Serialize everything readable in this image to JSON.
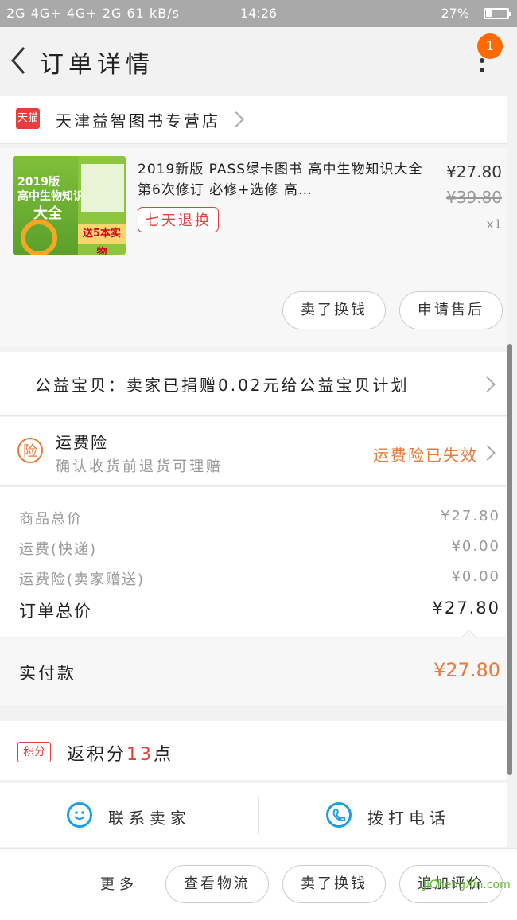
{
  "status_bar": {
    "signal": "2G 4G+ 4G+ 2G",
    "speed": "61 kB/s",
    "time": "14:26",
    "battery": "27%"
  },
  "nav": {
    "title": "订单详情",
    "badge": "1"
  },
  "shop": {
    "icon_text": "天猫",
    "name": "天津益智图书专营店"
  },
  "product": {
    "title": "2019新版 PASS绿卡图书 高中生物知识大全 第6次修订 必修+选修 高…",
    "tag": "七天退换",
    "price": "¥27.80",
    "original_price": "¥39.80",
    "quantity": "x1",
    "cover": {
      "badge": "2019版",
      "line1": "高中生物知识",
      "line2": "大全",
      "promo": "送5本实物"
    },
    "actions": [
      "卖了换钱",
      "申请售后"
    ]
  },
  "charity": {
    "text": "公益宝贝：卖家已捐赠0.02元给公益宝贝计划"
  },
  "insurance": {
    "icon": "险",
    "title": "运费险",
    "subtitle": "确认收货前退货可理赔",
    "status": "运费险已失效"
  },
  "summary": [
    {
      "label": "商品总价",
      "value": "¥27.80"
    },
    {
      "label": "运费(快递)",
      "value": "¥0.00"
    },
    {
      "label": "运费险(卖家赠送)",
      "value": "¥0.00"
    },
    {
      "label": "订单总价",
      "value": "¥27.80"
    }
  ],
  "payment": {
    "label": "实付款",
    "value": "¥27.80"
  },
  "points": {
    "icon": "积分",
    "prefix": "返积分",
    "number": "13",
    "suffix": "点"
  },
  "contact": {
    "seller": "联系卖家",
    "phone": "拨打电话"
  },
  "bottom_bar": {
    "more": "更多",
    "buttons": [
      "查看物流",
      "卖了换钱",
      "追加评价"
    ]
  },
  "watermark": "JiChengXin.com",
  "colors": {
    "accent": "#e57a3b",
    "red": "#e53e3e",
    "blue": "#1e9ee6",
    "badge": "#ff6a00"
  }
}
